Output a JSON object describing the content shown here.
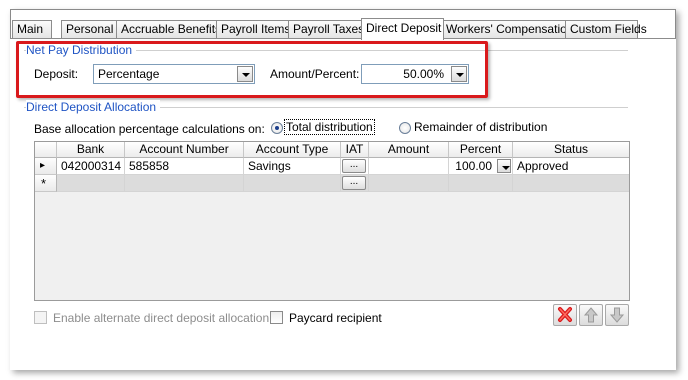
{
  "tabs": [
    {
      "label": "Main"
    },
    {
      "label": "Personal"
    },
    {
      "label": "Accruable Benefits"
    },
    {
      "label": "Payroll Items"
    },
    {
      "label": "Payroll Taxes"
    },
    {
      "label": "Direct Deposit",
      "active": true
    },
    {
      "label": "Workers' Compensation"
    },
    {
      "label": "Custom Fields"
    }
  ],
  "net_pay": {
    "title": "Net Pay Distribution",
    "deposit_label": "Deposit:",
    "deposit_value": "Percentage",
    "amount_label": "Amount/Percent:",
    "amount_value": "50.00%"
  },
  "allocation": {
    "title": "Direct Deposit Allocation",
    "base_label": "Base allocation percentage calculations on:",
    "option_total": "Total distribution",
    "option_remainder": "Remainder of distribution",
    "selected": "Total distribution"
  },
  "grid": {
    "columns": [
      "Bank",
      "Account Number",
      "Account Type",
      "IAT",
      "Amount",
      "Percent",
      "Status"
    ],
    "rows": [
      {
        "bank": "042000314",
        "account_number": "585858",
        "account_type": "Savings",
        "iat": "...",
        "amount": "",
        "percent": "100.00",
        "status": "Approved"
      },
      {
        "bank": "",
        "account_number": "",
        "account_type": "",
        "iat": "...",
        "amount": "",
        "percent": "",
        "status": ""
      }
    ],
    "row_marker_current": "▸",
    "row_marker_new": "*"
  },
  "bottom": {
    "alt_allocation_label": "Enable alternate direct deposit allocation",
    "paycard_label": "Paycard recipient"
  },
  "colors": {
    "accent": "#1f54c4",
    "highlight_box": "#d9191c",
    "delete_icon": "#d9191c"
  },
  "icons": {
    "delete": "delete-x-icon",
    "move_up": "arrow-up-icon",
    "move_down": "arrow-down-icon"
  }
}
